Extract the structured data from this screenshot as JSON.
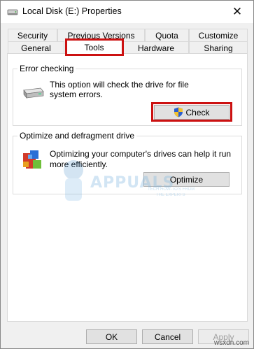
{
  "window": {
    "title": "Local Disk (E:) Properties",
    "close_glyph": "✕"
  },
  "tabs": {
    "row_top": [
      {
        "label": "Security"
      },
      {
        "label": "Previous Versions"
      },
      {
        "label": "Quota"
      },
      {
        "label": "Customize"
      }
    ],
    "row_bottom": [
      {
        "label": "General"
      },
      {
        "label": "Tools",
        "selected": true
      },
      {
        "label": "Hardware"
      },
      {
        "label": "Sharing"
      }
    ]
  },
  "error_checking": {
    "title": "Error checking",
    "description_line1": "This option will check the drive for file",
    "description_line2": "system errors.",
    "check_button": "Check",
    "icon": "drive-icon",
    "button_icon": "uac-shield-icon"
  },
  "optimize": {
    "title": "Optimize and defragment drive",
    "description_line1": "Optimizing your computer's drives can help it run",
    "description_line2": "more efficiently.",
    "optimize_button": "Optimize",
    "icon": "defrag-icon"
  },
  "watermark": {
    "brand": "APPUALS",
    "tagline_1": "TECH HOW-TO'S FROM",
    "tagline_2": "THE EXPERTS"
  },
  "footer": {
    "ok": "OK",
    "cancel": "Cancel",
    "apply": "Apply",
    "site": "wsxdn.com"
  },
  "colors": {
    "highlight": "#cc1111",
    "panel_bg": "#ffffff",
    "window_bg": "#f0f0f0"
  }
}
